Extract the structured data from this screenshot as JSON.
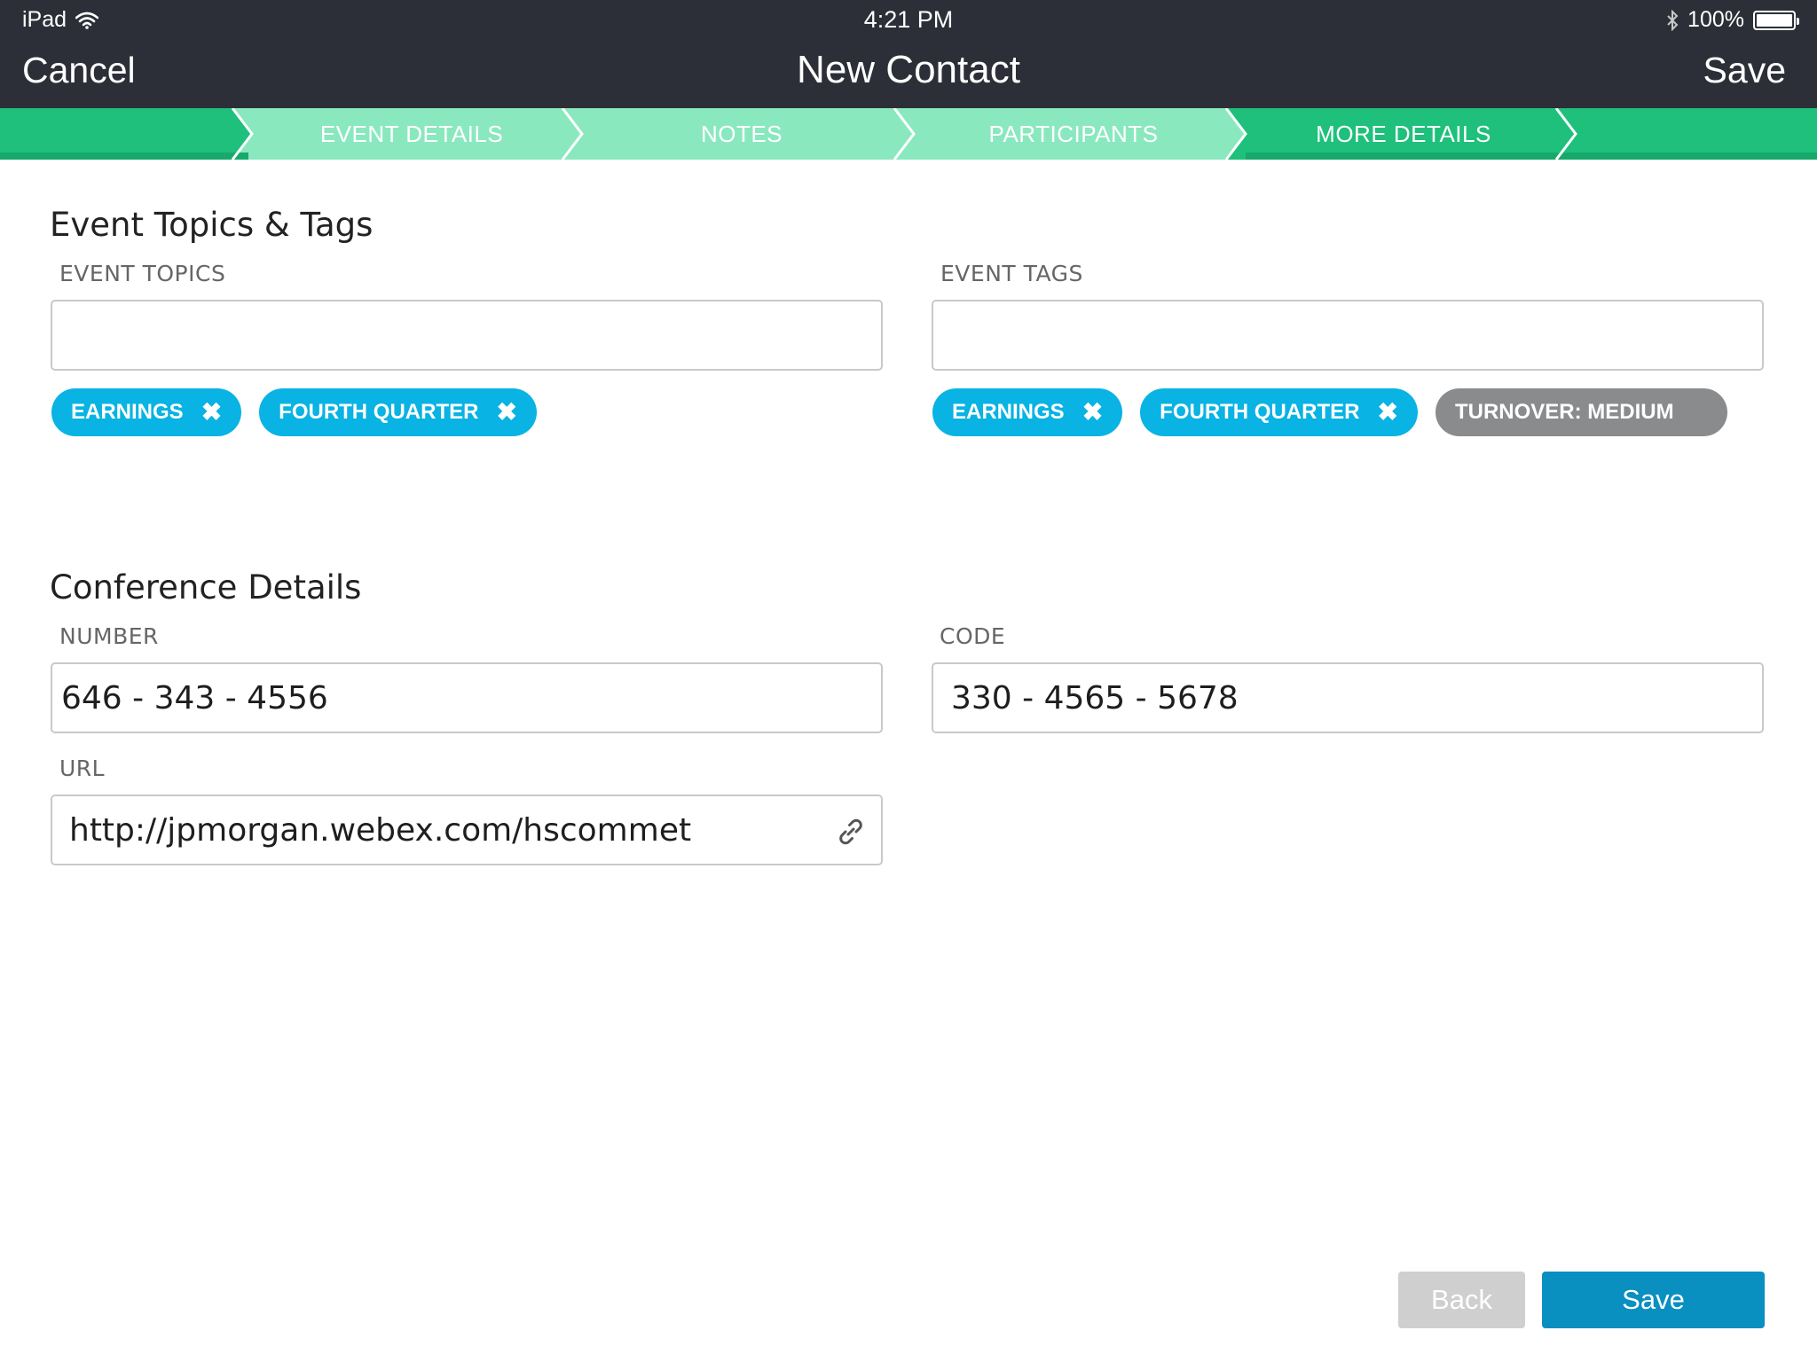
{
  "status_bar": {
    "device": "iPad",
    "time": "4:21 PM",
    "battery": "100%",
    "icons": [
      "wifi-icon",
      "bluetooth-icon",
      "battery-icon"
    ]
  },
  "nav": {
    "cancel_label": "Cancel",
    "title": "New Contact",
    "save_label": "Save"
  },
  "steps": [
    {
      "label": "EVENT DETAILS",
      "state": "completed"
    },
    {
      "label": "NOTES",
      "state": "completed"
    },
    {
      "label": "PARTICIPANTS",
      "state": "completed"
    },
    {
      "label": "MORE DETAILS",
      "state": "active"
    }
  ],
  "topics_section": {
    "title": "Event Topics & Tags",
    "topics": {
      "label": "EVENT TOPICS",
      "value": "",
      "chips": [
        "EARNINGS",
        "FOURTH QUARTER"
      ]
    },
    "tags": {
      "label": "EVENT TAGS",
      "value": "",
      "chips": [
        "EARNINGS",
        "FOURTH QUARTER"
      ],
      "suggested_chip": "TURNOVER: MEDIUM"
    }
  },
  "conference_section": {
    "title": "Conference Details",
    "number": {
      "label": "NUMBER",
      "value": "646 - 343 - 4556"
    },
    "code": {
      "label": "CODE",
      "value": "330 - 4565 - 5678"
    },
    "url": {
      "label": "URL",
      "value": "http://jpmorgan.webex.com/hscommet"
    }
  },
  "buttons": {
    "back_label": "Back",
    "save_label": "Save"
  },
  "colors": {
    "nav_bg": "#2d2f38",
    "step_active": "#1ec07c",
    "step_completed": "#8ae8bf",
    "chip_blue": "#09b3e3",
    "chip_gray": "#8a8b8d",
    "save_button": "#0a8fc1",
    "back_button": "#cfcfcf"
  }
}
